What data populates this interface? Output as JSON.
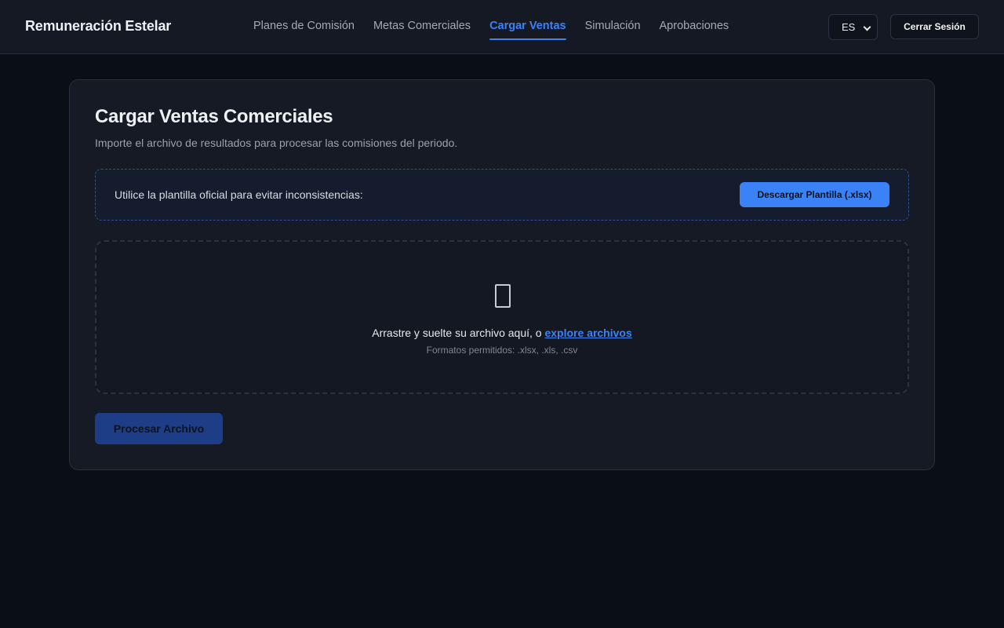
{
  "app": {
    "title": "Remuneración Estelar"
  },
  "nav": {
    "items": [
      {
        "label": "Planes de Comisión"
      },
      {
        "label": "Metas Comerciales"
      },
      {
        "label": "Cargar Ventas",
        "active": true
      },
      {
        "label": "Simulación"
      },
      {
        "label": "Aprobaciones"
      }
    ]
  },
  "header": {
    "language": {
      "selected": "ES"
    },
    "logout_label": "Cerrar Sesión"
  },
  "page": {
    "title": "Cargar Ventas Comerciales",
    "subtitle": "Importe el archivo de resultados para procesar las comisiones del periodo."
  },
  "template": {
    "text": "Utilice la plantilla oficial para evitar inconsistencias:",
    "download_label": "Descargar Plantilla (.xlsx)"
  },
  "dropzone": {
    "icon": "file-icon",
    "prompt": "Arrastre y suelte su archivo aquí, o",
    "browse_label": "explore archivos",
    "formats": "Formatos permitidos: .xlsx, .xls, .csv"
  },
  "actions": {
    "process_label": "Procesar Archivo"
  },
  "colors": {
    "accent": "#3b82f6",
    "background": "#0a0e17",
    "surface": "#151a24",
    "process_button": "#1d3d86"
  }
}
